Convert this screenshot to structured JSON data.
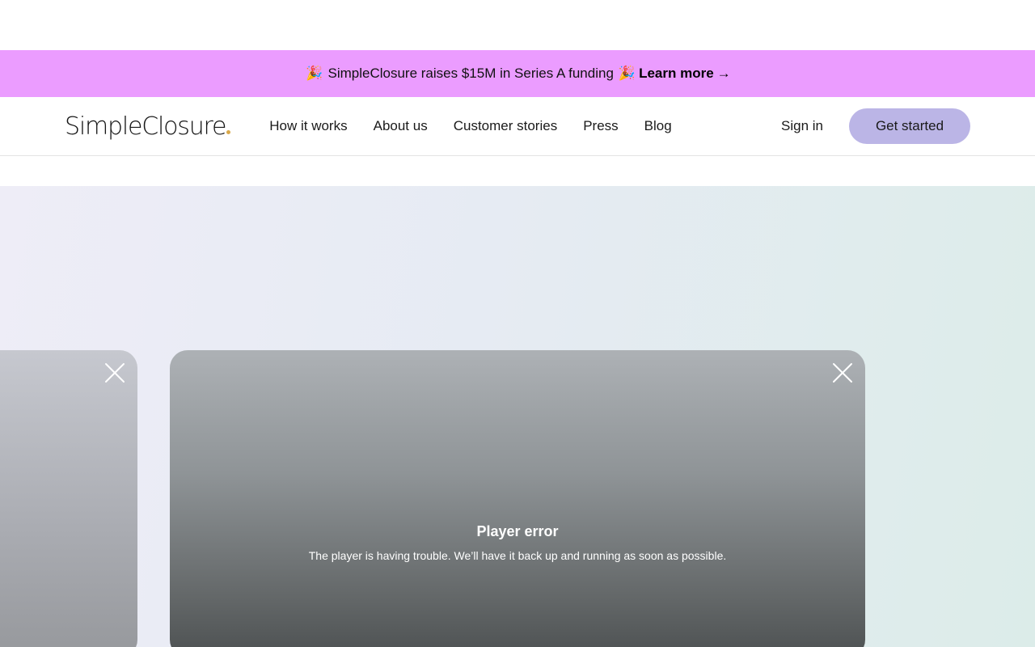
{
  "announcement": {
    "emoji_left": "🎉",
    "text": "SimpleClosure raises $15M in Series A funding",
    "emoji_right": "🎉",
    "link_label": "Learn more",
    "link_arrow": "→",
    "background": "#eb9cff"
  },
  "navbar": {
    "logo": "SimpleClosure",
    "links": [
      {
        "label": "How it works"
      },
      {
        "label": "About us"
      },
      {
        "label": "Customer stories"
      },
      {
        "label": "Press"
      },
      {
        "label": "Blog"
      }
    ],
    "sign_in": "Sign in",
    "cta": "Get started",
    "cta_color": "#bbb5e6"
  },
  "player": {
    "error_title": "Player error",
    "error_message": "The player is having trouble. We’ll have it back up and running as soon as possible."
  },
  "icons": {
    "close": "close-icon"
  }
}
